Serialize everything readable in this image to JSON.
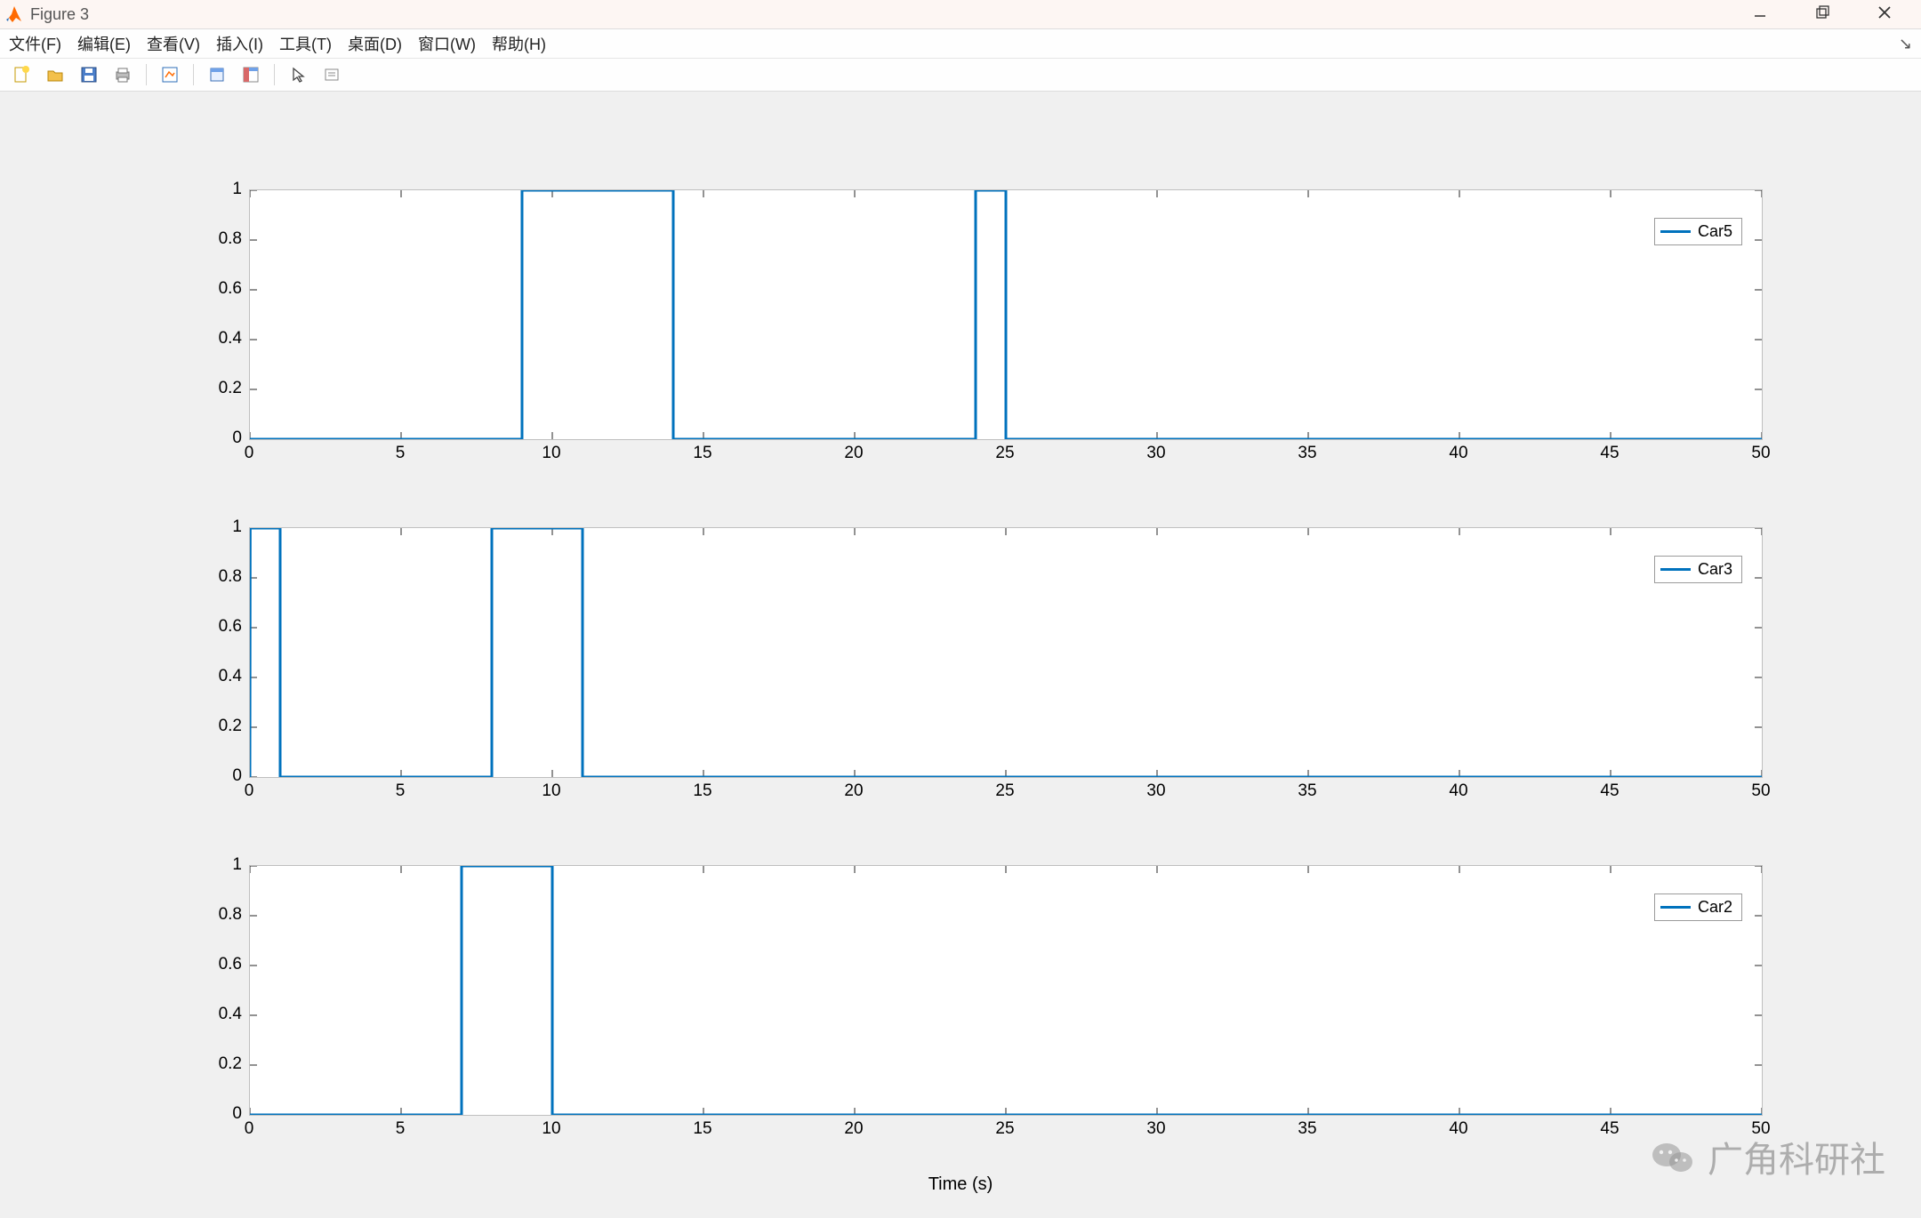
{
  "window": {
    "title": "Figure 3"
  },
  "menus": [
    "文件(F)",
    "编辑(E)",
    "查看(V)",
    "插入(I)",
    "工具(T)",
    "桌面(D)",
    "窗口(W)",
    "帮助(H)"
  ],
  "toolbar_icons": [
    "new",
    "open",
    "save",
    "print",
    "|",
    "link",
    "|",
    "win",
    "dash",
    "|",
    "arrow",
    "annot"
  ],
  "xlabel": "Time (s)",
  "watermark": "广角科研社",
  "colors": {
    "line": "#0072BD",
    "axis": "#262626",
    "tick": "#595959"
  },
  "chart_data": [
    {
      "type": "line",
      "legend": "Car5",
      "xlim": [
        0,
        50
      ],
      "ylim": [
        0,
        1
      ],
      "xticks": [
        0,
        5,
        10,
        15,
        20,
        25,
        30,
        35,
        40,
        45,
        50
      ],
      "yticks": [
        0,
        0.2,
        0.4,
        0.6,
        0.8,
        1
      ],
      "x": [
        0,
        9,
        9,
        14,
        14,
        24,
        24,
        25,
        25,
        50
      ],
      "y": [
        0,
        0,
        1,
        1,
        0,
        0,
        1,
        1,
        0,
        0
      ]
    },
    {
      "type": "line",
      "legend": "Car3",
      "xlim": [
        0,
        50
      ],
      "ylim": [
        0,
        1
      ],
      "xticks": [
        0,
        5,
        10,
        15,
        20,
        25,
        30,
        35,
        40,
        45,
        50
      ],
      "yticks": [
        0,
        0.2,
        0.4,
        0.6,
        0.8,
        1
      ],
      "x": [
        0,
        0.01,
        1,
        1,
        8,
        8,
        11,
        11,
        50
      ],
      "y": [
        0,
        1,
        1,
        0,
        0,
        1,
        1,
        0,
        0
      ]
    },
    {
      "type": "line",
      "legend": "Car2",
      "xlim": [
        0,
        50
      ],
      "ylim": [
        0,
        1
      ],
      "xticks": [
        0,
        5,
        10,
        15,
        20,
        25,
        30,
        35,
        40,
        45,
        50
      ],
      "yticks": [
        0,
        0.2,
        0.4,
        0.6,
        0.8,
        1
      ],
      "x": [
        0,
        7,
        7,
        10,
        10,
        50
      ],
      "y": [
        0,
        0,
        1,
        1,
        0,
        0
      ]
    }
  ]
}
